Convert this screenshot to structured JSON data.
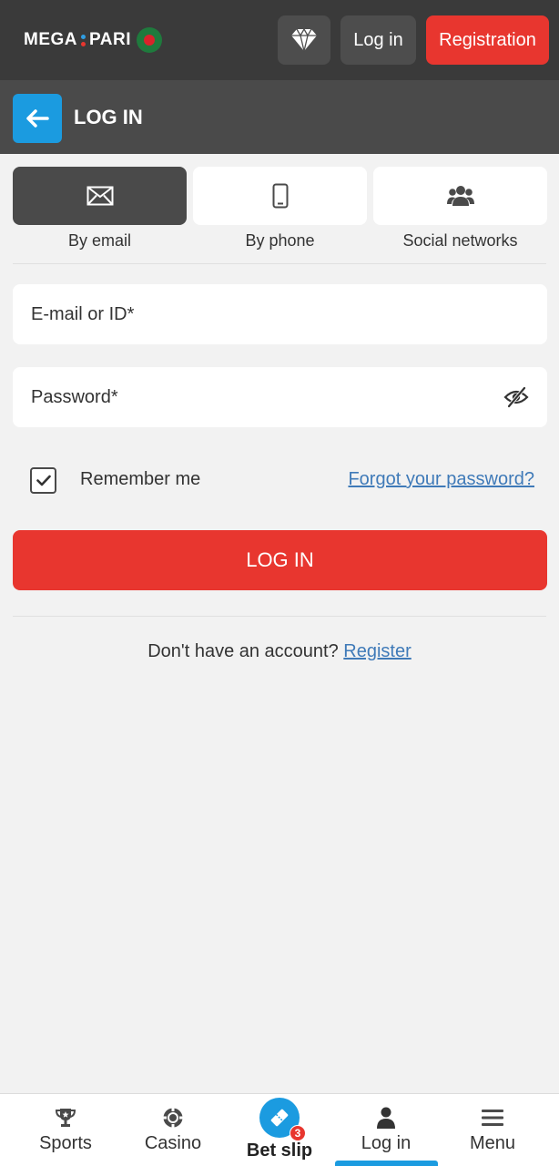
{
  "header": {
    "logo_left": "MEGA",
    "logo_right": "PARI",
    "login_label": "Log in",
    "registration_label": "Registration"
  },
  "subheader": {
    "title": "LOG IN"
  },
  "tabs": [
    {
      "label": "By email",
      "icon": "envelope-icon",
      "active": true
    },
    {
      "label": "By phone",
      "icon": "phone-icon",
      "active": false
    },
    {
      "label": "Social networks",
      "icon": "users-icon",
      "active": false
    }
  ],
  "form": {
    "email_placeholder": "E-mail or ID*",
    "email_value": "",
    "password_placeholder": "Password*",
    "password_value": "",
    "remember_label": "Remember me",
    "remember_checked": true,
    "forgot_label": "Forgot your password?",
    "submit_label": "LOG IN",
    "no_account_text": "Don't have an account?",
    "register_link": "Register"
  },
  "bottom_nav": [
    {
      "label": "Sports",
      "icon": "trophy-icon"
    },
    {
      "label": "Casino",
      "icon": "casino-chip-icon"
    },
    {
      "label": "Bet slip",
      "icon": "ticket-icon",
      "badge": "3"
    },
    {
      "label": "Log in",
      "icon": "user-icon",
      "active": true
    },
    {
      "label": "Menu",
      "icon": "hamburger-icon"
    }
  ],
  "colors": {
    "accent_red": "#e8362f",
    "accent_blue": "#1b9be0",
    "dark_bar": "#3a3a3a",
    "link_blue": "#3f7ab8"
  }
}
